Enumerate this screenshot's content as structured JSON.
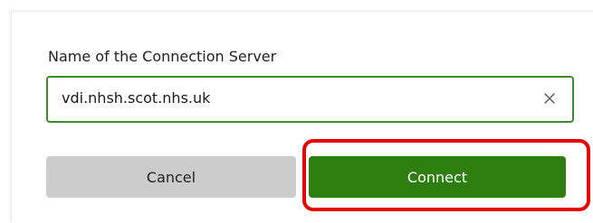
{
  "dialog": {
    "field_label": "Name of the Connection Server",
    "server_input": {
      "value": "vdi.nhsh.scot.nhs.uk",
      "clear_icon": "close-icon"
    },
    "cancel_label": "Cancel",
    "connect_label": "Connect"
  },
  "colors": {
    "accent_green": "#2e7d0f",
    "input_border": "#3f8a2f",
    "highlight_red": "#e60000",
    "cancel_gray": "#cccccc"
  }
}
